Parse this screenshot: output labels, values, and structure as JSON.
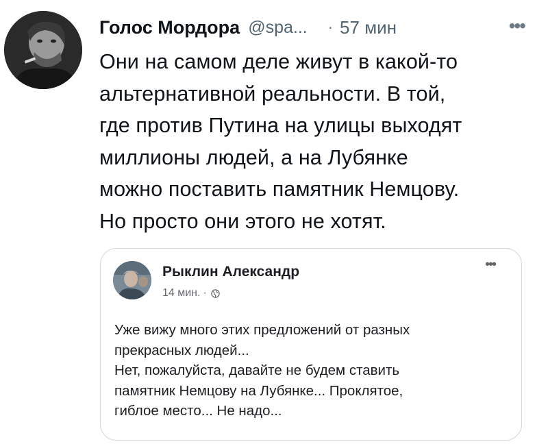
{
  "tweet": {
    "author_name": "Голос Мордора",
    "handle": "@spa...",
    "separator": "·",
    "time": "57 мин",
    "more_icon": "•••",
    "text_lines": [
      "Они на самом деле живут в какой-то",
      "альтернативной реальности. В той,",
      "где против Путина на улицы выходят",
      "миллионы людей, а на Лубянке",
      "можно поставить памятник Немцову.",
      "Но просто они этого не хотят."
    ]
  },
  "quote": {
    "author_name": "Рыклин Александр",
    "time": "14 мин.",
    "separator": "·",
    "privacy_icon": "globe-icon",
    "more_icon": "•••",
    "text_lines": [
      "Уже вижу много этих предложений от разных",
      "прекрасных людей...",
      "Нет, пожалуйста, давайте не будем ставить",
      "памятник Немцову на Лубянке... Проклятое,",
      "гиблое место... Не надо..."
    ]
  },
  "colors": {
    "text_primary": "#0f1419",
    "text_secondary": "#536471",
    "card_border": "#cfd9de",
    "fb_text": "#1c1e21",
    "fb_secondary": "#65676b"
  }
}
